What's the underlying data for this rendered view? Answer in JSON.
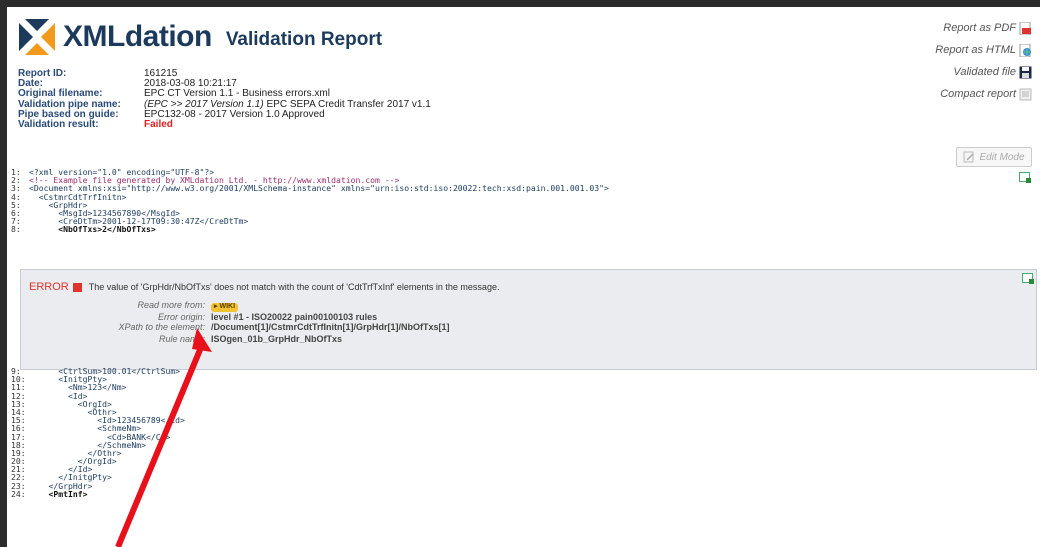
{
  "header": {
    "logo_text": "XMLdation",
    "report_title": "Validation Report"
  },
  "meta": [
    {
      "label": "Report ID:",
      "value": "161215"
    },
    {
      "label": "Date:",
      "value": "2018-03-08 10:21:17"
    },
    {
      "label": "Original filename:",
      "value": "EPC CT Version 1.1 - Business errors.xml"
    },
    {
      "label": "Validation pipe name:",
      "value_italic": "(EPC >> 2017 Version 1.1)",
      "value": " EPC SEPA Credit Transfer 2017 v1.1"
    },
    {
      "label": "Pipe based on guide:",
      "value": "EPC132-08 - 2017 Version 1.0 Approved"
    },
    {
      "label": "Validation result:",
      "value": "Failed",
      "status": "failed"
    }
  ],
  "actions": {
    "report_pdf": "Report as PDF",
    "report_html": "Report as HTML",
    "validated_file": "Validated file",
    "compact_report": "Compact report",
    "edit_mode": "Edit Mode"
  },
  "code_top": [
    {
      "n": "1:",
      "t": "<?xml version=\"1.0\" encoding=\"UTF-8\"?>",
      "kind": "decl"
    },
    {
      "n": "2:",
      "t": "<!-- Example file generated by XMLdation Ltd. - http://www.xmldation.com -->",
      "kind": "comment"
    },
    {
      "n": "3:",
      "t": "<Document xmlns:xsi=\"http://www.w3.org/2001/XMLSchema-instance\" xmlns=\"urn:iso:std:iso:20022:tech:xsd:pain.001.001.03\">",
      "kind": "doc"
    },
    {
      "n": "4:",
      "t": "  <CstmrCdtTrfInitn>",
      "kind": "tag"
    },
    {
      "n": "5:",
      "t": "    <GrpHdr>",
      "kind": "tag"
    },
    {
      "n": "6:",
      "t": "      <MsgId>1234567890</MsgId>",
      "kind": "tag"
    },
    {
      "n": "7:",
      "t": "      <CreDtTm>2001-12-17T09:30:47Z</CreDtTm>",
      "kind": "tag"
    },
    {
      "n": "8:",
      "t": "      <NbOfTxs>2</NbOfTxs>",
      "kind": "bold"
    }
  ],
  "error": {
    "label": "ERROR",
    "message": "The value of 'GrpHdr/NbOfTxs' does not match with the count of 'CdtTrfTxInf' elements in the message.",
    "details": [
      {
        "label": "Read more from:",
        "value": "",
        "wiki": "WIKI"
      },
      {
        "label": "Error origin:",
        "value": "level #1 - ISO20022 pain00100103 rules"
      },
      {
        "label": "XPath to the element:",
        "value": "/Document[1]/CstmrCdtTrfInitn[1]/GrpHdr[1]/NbOfTxs[1]"
      },
      {
        "label": "Rule name:",
        "value": "ISOgen_01b_GrpHdr_NbOfTxs"
      }
    ]
  },
  "code_bottom": [
    {
      "n": "9:",
      "t": "      <CtrlSum>100.01</CtrlSum>",
      "kind": "tag"
    },
    {
      "n": "10:",
      "t": "      <InitgPty>",
      "kind": "tag"
    },
    {
      "n": "11:",
      "t": "        <Nm>123</Nm>",
      "kind": "tag"
    },
    {
      "n": "12:",
      "t": "        <Id>",
      "kind": "tag"
    },
    {
      "n": "13:",
      "t": "          <OrgId>",
      "kind": "tag"
    },
    {
      "n": "14:",
      "t": "            <Othr>",
      "kind": "tag"
    },
    {
      "n": "15:",
      "t": "              <Id>123456789</Id>",
      "kind": "tag"
    },
    {
      "n": "16:",
      "t": "              <SchmeNm>",
      "kind": "tag"
    },
    {
      "n": "17:",
      "t": "                <Cd>BANK</Cd>",
      "kind": "tag"
    },
    {
      "n": "18:",
      "t": "              </SchmeNm>",
      "kind": "tag"
    },
    {
      "n": "19:",
      "t": "            </Othr>",
      "kind": "tag"
    },
    {
      "n": "20:",
      "t": "          </OrgId>",
      "kind": "tag"
    },
    {
      "n": "21:",
      "t": "        </Id>",
      "kind": "tag"
    },
    {
      "n": "22:",
      "t": "      </InitgPty>",
      "kind": "tag"
    },
    {
      "n": "23:",
      "t": "    </GrpHdr>",
      "kind": "tag"
    },
    {
      "n": "24:",
      "t": "    <PmtInf>",
      "kind": "bold"
    }
  ],
  "colors": {
    "brand_blue": "#1b3a5c",
    "error_red": "#e0332b",
    "wiki_yellow": "#f1c232",
    "annotation_arrow": "#e8101a"
  }
}
